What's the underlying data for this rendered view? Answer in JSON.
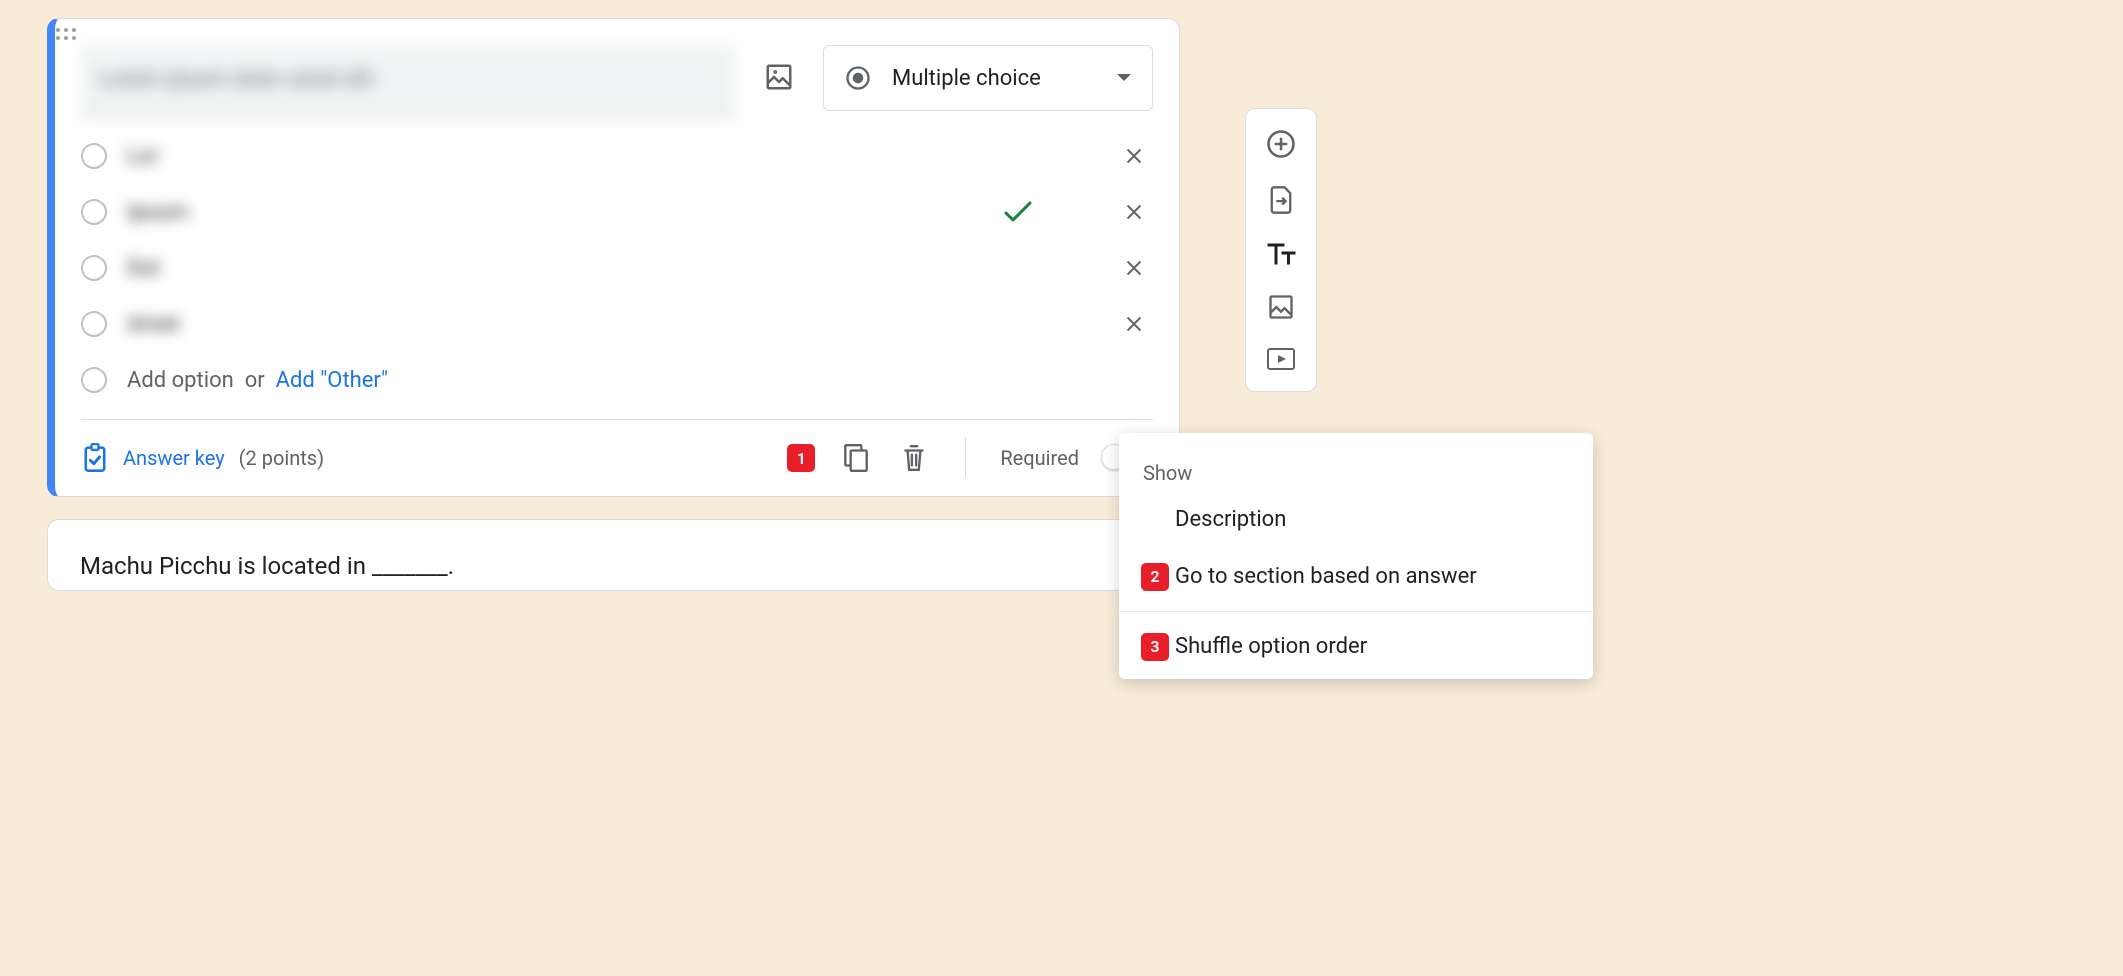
{
  "question": {
    "text": "Lorem ipsum dolor amet elit",
    "type_label": "Multiple choice"
  },
  "options": [
    {
      "text": "Lor",
      "correct": false
    },
    {
      "text": "Ipsum",
      "correct": true
    },
    {
      "text": "Dol",
      "correct": false
    },
    {
      "text": "Amet",
      "correct": false
    }
  ],
  "add_option": {
    "add_label": "Add option",
    "or_label": "or",
    "other_label": "Add \"Other\""
  },
  "footer": {
    "answer_key": "Answer key",
    "points": "(2 points)",
    "required": "Required"
  },
  "badges": {
    "b1": "1",
    "b2": "2",
    "b3": "3"
  },
  "popover": {
    "show": "Show",
    "description": "Description",
    "goto_section": "Go to section based on answer",
    "shuffle": "Shuffle option order"
  },
  "next_question": "Machu Picchu is located in _______."
}
